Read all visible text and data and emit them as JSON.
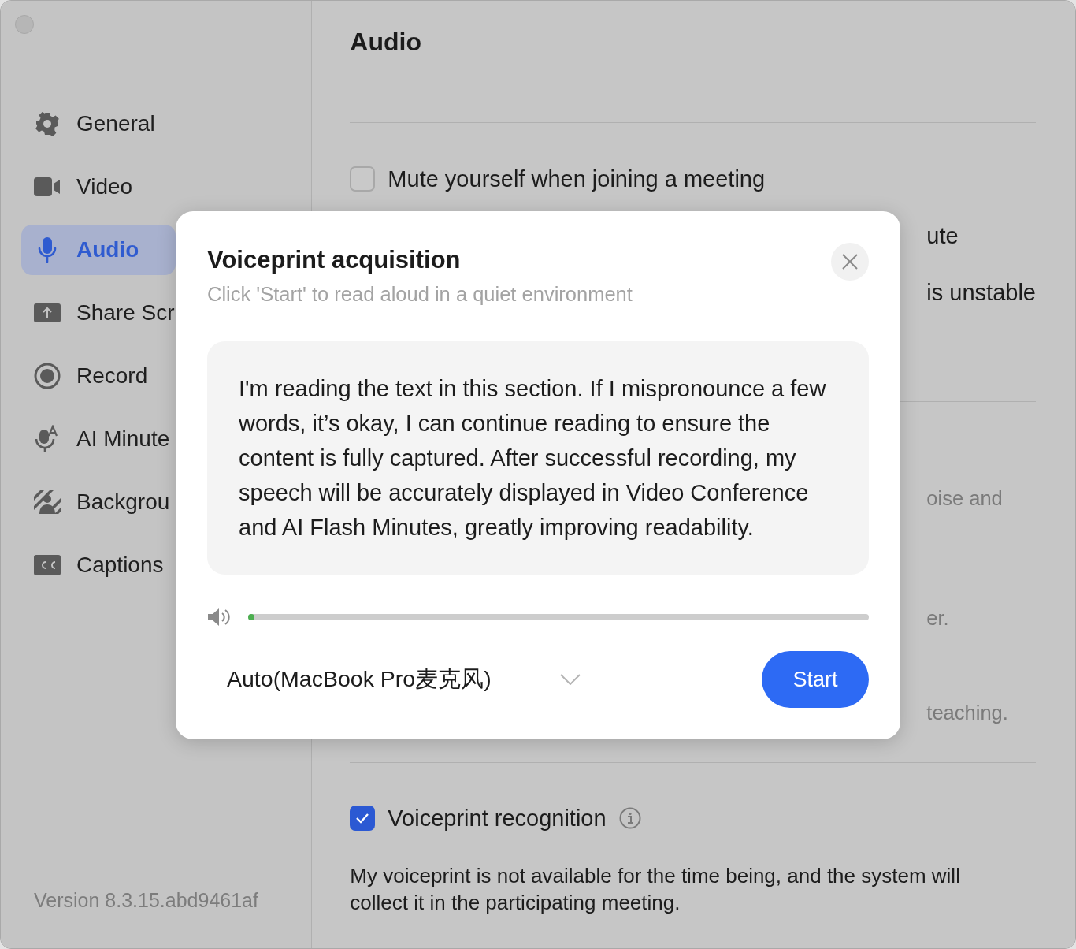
{
  "window": {
    "title": "Audio"
  },
  "sidebar": {
    "items": [
      {
        "label": "General",
        "selected": false
      },
      {
        "label": "Video",
        "selected": false
      },
      {
        "label": "Audio",
        "selected": true
      },
      {
        "label": "Share Scr",
        "selected": false
      },
      {
        "label": "Record",
        "selected": false
      },
      {
        "label": "AI Minute",
        "selected": false
      },
      {
        "label": "Backgrou",
        "selected": false
      },
      {
        "label": "Captions",
        "selected": false
      }
    ],
    "version": "Version 8.3.15.abd9461af"
  },
  "settings": {
    "mute_on_join": {
      "label": "Mute yourself when joining a meeting",
      "checked": false
    },
    "partial_labels": [
      "ute",
      "is unstable"
    ],
    "partial_hints": [
      "oise and",
      "er.",
      "teaching."
    ],
    "voiceprint": {
      "label": "Voiceprint recognition",
      "checked": true
    },
    "voiceprint_note": "My voiceprint is not available for the time being, and the system will collect it in the participating meeting."
  },
  "dialog": {
    "title": "Voiceprint acquisition",
    "subtitle": "Click 'Start' to read aloud in a quiet environment",
    "script": "I'm reading the text in this section. If I mispronounce a few words, it’s okay, I can continue reading to ensure the content is fully captured. After successful recording, my speech will be accurately displayed in Video Conference and AI Flash Minutes, greatly improving readability.",
    "meter": {
      "level": 0.01
    },
    "microphone": "Auto(MacBook Pro麦克风)",
    "start_button": "Start"
  }
}
